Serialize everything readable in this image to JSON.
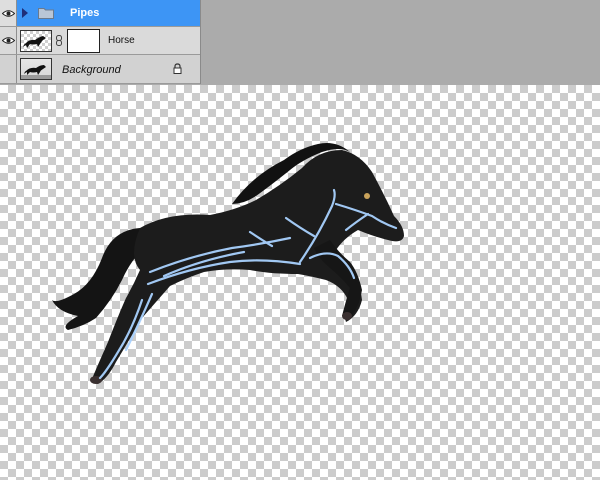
{
  "layers": [
    {
      "name": "Pipes",
      "type": "group",
      "selected": true
    },
    {
      "name": "Horse",
      "type": "layer",
      "has_mask": true
    },
    {
      "name": "Background",
      "type": "background",
      "locked": true
    }
  ],
  "icons": {
    "visibility": "eye-icon",
    "group": "folder-icon",
    "disclosure": "triangle-right-icon",
    "mask_link": "chain-link-icon",
    "lock": "lock-icon"
  },
  "colors": {
    "selected_row": "#3d95f5",
    "panel_bg": "#d4d4d4",
    "workspace_bg": "#ababab",
    "horse": "#1c1c1c",
    "pipes": "#a9d2ff"
  },
  "canvas": {
    "background": "transparency-checkerboard",
    "subject": "black horse with glowing pipe lines"
  }
}
